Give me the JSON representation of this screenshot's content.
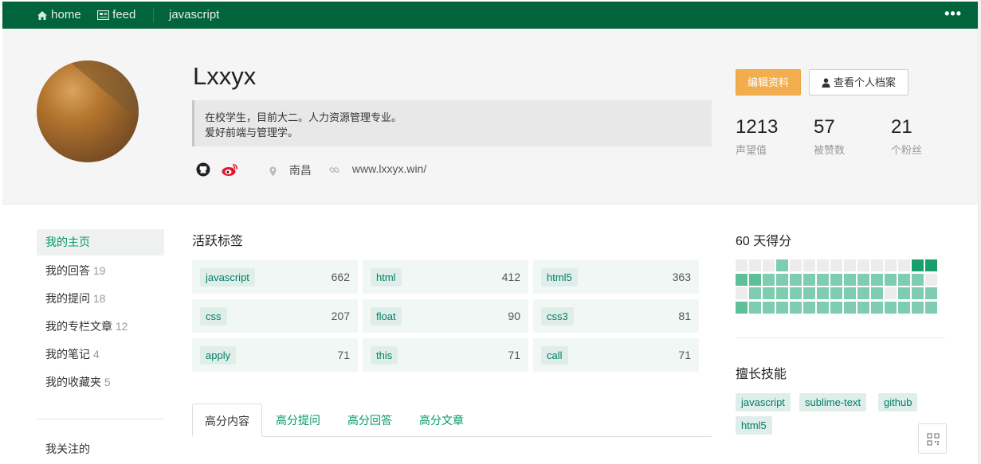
{
  "nav": {
    "home_label": "home",
    "feed_label": "feed",
    "tag_label": "javascript",
    "more_label": "•••"
  },
  "profile": {
    "username": "Lxxyx",
    "bio_line1": "在校学生，目前大二。人力资源管理专业。",
    "bio_line2": "爱好前端与管理学。",
    "location": "南昌",
    "website": "www.lxxyx.win/",
    "edit_button": "编辑资料",
    "view_profile_button": "查看个人档案"
  },
  "stats": [
    {
      "value": "1213",
      "label": "声望值"
    },
    {
      "value": "57",
      "label": "被赞数"
    },
    {
      "value": "21",
      "label": "个粉丝"
    }
  ],
  "sidebar": {
    "items": [
      {
        "label": "我的主页",
        "count": ""
      },
      {
        "label": "我的回答",
        "count": "19"
      },
      {
        "label": "我的提问",
        "count": "18"
      },
      {
        "label": "我的专栏文章",
        "count": "12"
      },
      {
        "label": "我的笔记",
        "count": "4"
      },
      {
        "label": "我的收藏夹",
        "count": "5"
      }
    ],
    "following_label": "我关注的"
  },
  "active_tags": {
    "title": "活跃标签",
    "tags": [
      {
        "name": "javascript",
        "count": "662"
      },
      {
        "name": "html",
        "count": "412"
      },
      {
        "name": "html5",
        "count": "363"
      },
      {
        "name": "css",
        "count": "207"
      },
      {
        "name": "float",
        "count": "90"
      },
      {
        "name": "css3",
        "count": "81"
      },
      {
        "name": "apply",
        "count": "71"
      },
      {
        "name": "this",
        "count": "71"
      },
      {
        "name": "call",
        "count": "71"
      }
    ]
  },
  "content_tabs": [
    "高分内容",
    "高分提问",
    "高分回答",
    "高分文章"
  ],
  "score_panel": {
    "title": "60 天得分",
    "colors": {
      "empty": "#ececec",
      "light": "#7fcdb0",
      "mid": "#5fbf98",
      "dark": "#17a06e"
    }
  },
  "skills": {
    "title": "擅长技能",
    "items": [
      "javascript",
      "sublime-text",
      "github",
      "html5"
    ]
  },
  "colors": {
    "nav_bg": "#01643a",
    "accent": "#019a61",
    "edit_button": "#f1ad4e"
  }
}
